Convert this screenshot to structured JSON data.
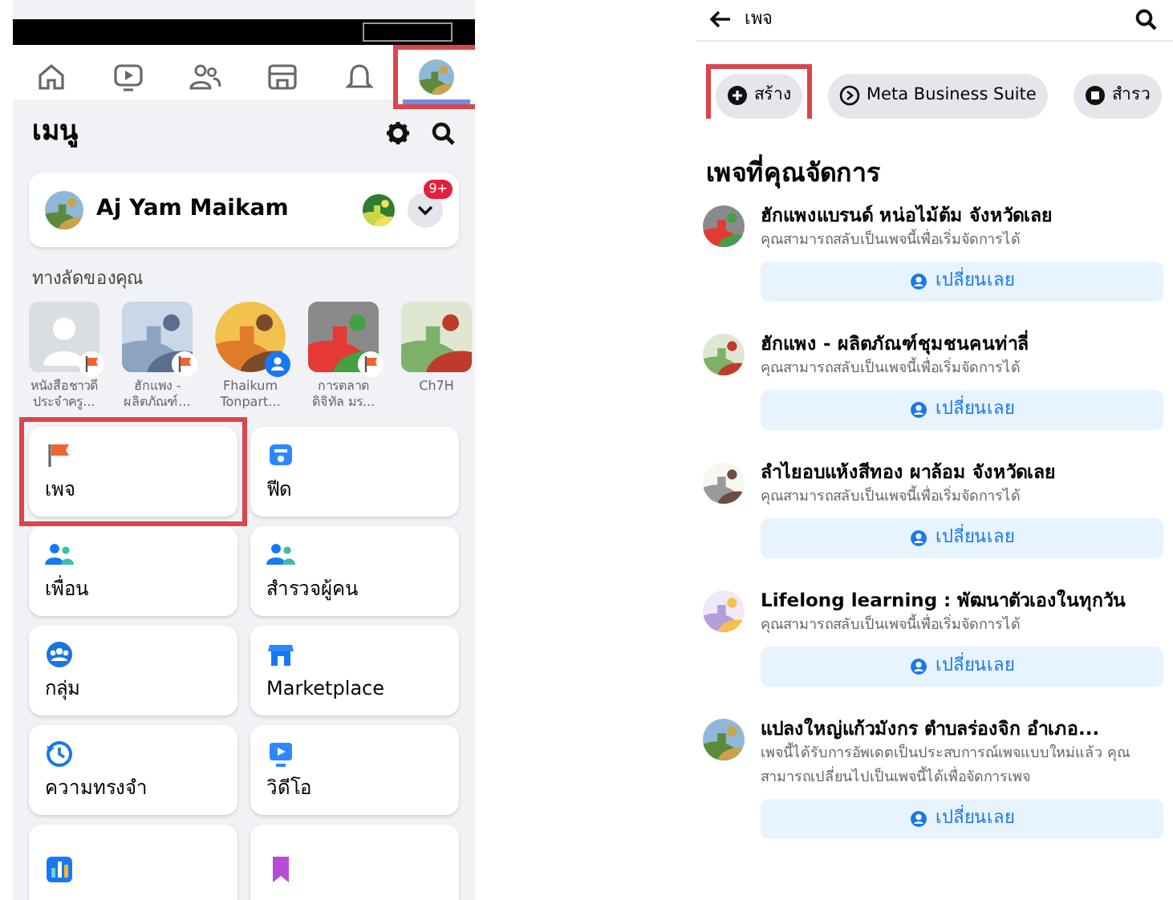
{
  "left_screen": {
    "nav_tabs": [
      {
        "kind": "home",
        "selected": false,
        "highlighted": false
      },
      {
        "kind": "video",
        "selected": false,
        "highlighted": false
      },
      {
        "kind": "friends",
        "selected": false,
        "highlighted": false
      },
      {
        "kind": "marketplace",
        "selected": false,
        "highlighted": false
      },
      {
        "kind": "notifications",
        "selected": false,
        "highlighted": false
      },
      {
        "kind": "profile",
        "selected": true,
        "highlighted": true
      }
    ],
    "menu_title": "เมนู",
    "profile": {
      "name": "Aj Yam Maikam",
      "notification_badge": "9+"
    },
    "shortcuts_title": "ทางลัดของคุณ",
    "shortcuts": [
      {
        "kind": "placeholder",
        "label": "หนังสือชาวดี ประจำครู...",
        "badge": {
          "kind": "page"
        }
      },
      {
        "kind": "picture",
        "label": "ฮักแพง - ผลิตภัณฑ์...",
        "badge": {
          "kind": "page"
        }
      },
      {
        "kind": "picture",
        "label": "Fhaikum Tonpart...",
        "badge": {
          "kind": "group"
        }
      },
      {
        "kind": "picture",
        "label": "การตลาด ดิจิทัล มร...",
        "badge": {
          "kind": "page"
        }
      },
      {
        "kind": "picture",
        "label": "Ch7H"
      }
    ],
    "menu_cards": [
      {
        "kind": "pages",
        "label": "เพจ",
        "highlighted": true
      },
      {
        "kind": "feed",
        "label": "ฟีด",
        "highlighted": false
      },
      {
        "kind": "friends",
        "label": "เพื่อน",
        "highlighted": false
      },
      {
        "kind": "explore",
        "label": "สำรวจผู้คน",
        "highlighted": false
      },
      {
        "kind": "groups",
        "label": "กลุ่ม",
        "highlighted": false
      },
      {
        "kind": "marketplace",
        "label": "Marketplace",
        "highlighted": false
      },
      {
        "kind": "memories",
        "label": "ความทรงจำ",
        "highlighted": false
      },
      {
        "kind": "video",
        "label": "วิดีโอ",
        "highlighted": false
      },
      {
        "kind": "insights",
        "highlighted": false
      },
      {
        "kind": "saved",
        "highlighted": false
      }
    ]
  },
  "right_screen": {
    "title": "เพจ",
    "chips": [
      {
        "kind": "create",
        "label": "สร้าง",
        "highlighted": true
      },
      {
        "kind": "business",
        "label": "Meta Business Suite",
        "highlighted": false
      },
      {
        "kind": "explore",
        "label": "สำรว",
        "highlighted": false
      }
    ],
    "section_title": "เพจที่คุณจัดการ",
    "pages": [
      {
        "name": "ฮักแพงแบรนด์ หน่อไม้ต้ม จังหวัดเลย",
        "description": "คุณสามารถสลับเป็นเพจนี้เพื่อเริ่มจัดการได้",
        "button": "เปลี่ยนเลย"
      },
      {
        "name": "ฮักแพง - ผลิตภัณฑ์ชุมชนคนท่าลี่",
        "description": "คุณสามารถสลับเป็นเพจนี้เพื่อเริ่มจัดการได้",
        "button": "เปลี่ยนเลย"
      },
      {
        "name": "ลำไยอบแห้งสีทอง ผาล้อม จังหวัดเลย",
        "description": "คุณสามารถสลับเป็นเพจนี้เพื่อเริ่มจัดการได้",
        "button": "เปลี่ยนเลย"
      },
      {
        "name": "Lifelong learning : พัฒนาตัวเองในทุกวัน",
        "description": "คุณสามารถสลับเป็นเพจนี้เพื่อเริ่มจัดการได้",
        "button": "เปลี่ยนเลย"
      },
      {
        "name": "แปลงใหญ่แก้วมังกร ตำบลร่องจิก อำเภอ...",
        "description": "เพจนี้ได้รับการอัพเดตเป็นประสบการณ์เพจแบบใหม่แล้ว คุณสามารถเปลี่ยนไปเป็นเพจนี้ได้เพื่อจัดการเพจ",
        "button": "เปลี่ยนเลย"
      }
    ]
  }
}
